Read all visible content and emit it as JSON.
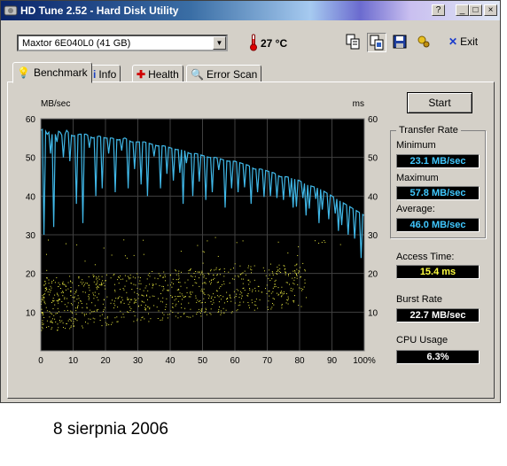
{
  "window": {
    "title": "HD Tune 2.52 - Hard Disk Utility",
    "controls": {
      "help": "?",
      "minimize": "_",
      "maximize": "□",
      "close": "×"
    }
  },
  "toolbar": {
    "drive_selected": "Maxtor 6E040L0 (41 GB)",
    "temperature": "27 °C",
    "exit_label": "Exit",
    "icons": [
      "copy-text-icon",
      "copy-screenshot-icon",
      "save-icon",
      "options-icon",
      "exit-icon"
    ]
  },
  "tabs": [
    {
      "label": "Benchmark",
      "icon": "lightbulb-icon",
      "active": true
    },
    {
      "label": "Info",
      "icon": "info-icon",
      "active": false
    },
    {
      "label": "Health",
      "icon": "health-cross-icon",
      "active": false
    },
    {
      "label": "Error Scan",
      "icon": "magnifier-icon",
      "active": false
    }
  ],
  "benchmark": {
    "start_label": "Start",
    "transfer_rate_title": "Transfer Rate",
    "minimum_label": "Minimum",
    "minimum_value": "23.1 MB/sec",
    "maximum_label": "Maximum",
    "maximum_value": "57.8 MB/sec",
    "average_label": "Average:",
    "average_value": "46.0 MB/sec",
    "access_time_label": "Access Time:",
    "access_time_value": "15.4 ms",
    "burst_rate_label": "Burst Rate",
    "burst_rate_value": "22.7 MB/sec",
    "cpu_usage_label": "CPU Usage",
    "cpu_usage_value": "6.3%"
  },
  "chart_data": {
    "type": "line",
    "left_unit": "MB/sec",
    "right_unit": "ms",
    "x_ticks": [
      "0",
      "10",
      "20",
      "30",
      "40",
      "50",
      "60",
      "70",
      "80",
      "90",
      "100%"
    ],
    "y_ticks_left": [
      "60",
      "50",
      "40",
      "30",
      "20",
      "10"
    ],
    "y_ticks_right": [
      "60",
      "50",
      "40",
      "30",
      "20",
      "10"
    ],
    "xlim": [
      0,
      100
    ],
    "ylim": [
      0,
      60
    ],
    "grid": true,
    "colors": {
      "transfer": "#40b8e8",
      "access": "#e8e840",
      "background": "#000000",
      "grid": "#404040"
    },
    "series": [
      {
        "name": "Transfer Rate",
        "x": [
          0,
          1,
          2,
          3,
          4,
          5,
          6,
          7,
          8,
          9,
          10,
          12,
          14,
          16,
          18,
          20,
          22,
          24,
          26,
          28,
          30,
          32,
          34,
          36,
          38,
          40,
          42,
          44,
          46,
          48,
          50,
          52,
          54,
          56,
          58,
          60,
          62,
          64,
          66,
          68,
          70,
          72,
          74,
          76,
          78,
          80,
          82,
          84,
          86,
          88,
          90,
          92,
          94,
          96,
          98,
          100
        ],
        "values": [
          57,
          57.5,
          56,
          57,
          55,
          57,
          56.5,
          55,
          57,
          56,
          55.5,
          56,
          56,
          55,
          55.5,
          55,
          55,
          54.5,
          55,
          54,
          54,
          54,
          53.5,
          53,
          53,
          52.5,
          52,
          52,
          51,
          51,
          50.5,
          50,
          50,
          49.5,
          49,
          49,
          48.5,
          48,
          47,
          47,
          46.5,
          46,
          45,
          45,
          44.5,
          44,
          43,
          42.5,
          42,
          41,
          40,
          39,
          38,
          37,
          36,
          35
        ],
        "dips": [
          [
            1,
            30
          ],
          [
            4,
            32
          ],
          [
            11,
            38
          ],
          [
            13,
            33
          ],
          [
            17,
            40
          ],
          [
            19,
            42
          ],
          [
            23,
            41
          ],
          [
            27,
            42
          ],
          [
            31,
            43
          ],
          [
            33,
            40
          ],
          [
            37,
            42
          ],
          [
            41,
            44
          ],
          [
            44,
            38
          ],
          [
            47,
            40
          ],
          [
            51,
            39
          ],
          [
            53,
            41
          ],
          [
            57,
            37
          ],
          [
            61,
            41
          ],
          [
            65,
            38
          ],
          [
            67,
            41
          ],
          [
            71,
            40
          ],
          [
            75,
            39
          ],
          [
            78,
            37
          ],
          [
            82,
            35
          ],
          [
            86,
            33
          ],
          [
            89,
            34
          ],
          [
            92,
            31
          ],
          [
            95,
            30
          ],
          [
            97,
            29
          ],
          [
            99,
            24
          ]
        ]
      },
      {
        "name": "Access Time",
        "points_count": 900,
        "x_range": [
          0,
          100
        ],
        "y_trend_start": [
          5,
          19
        ],
        "y_trend_end": [
          13,
          24
        ]
      }
    ]
  },
  "caption": "8 sierpnia 2006"
}
